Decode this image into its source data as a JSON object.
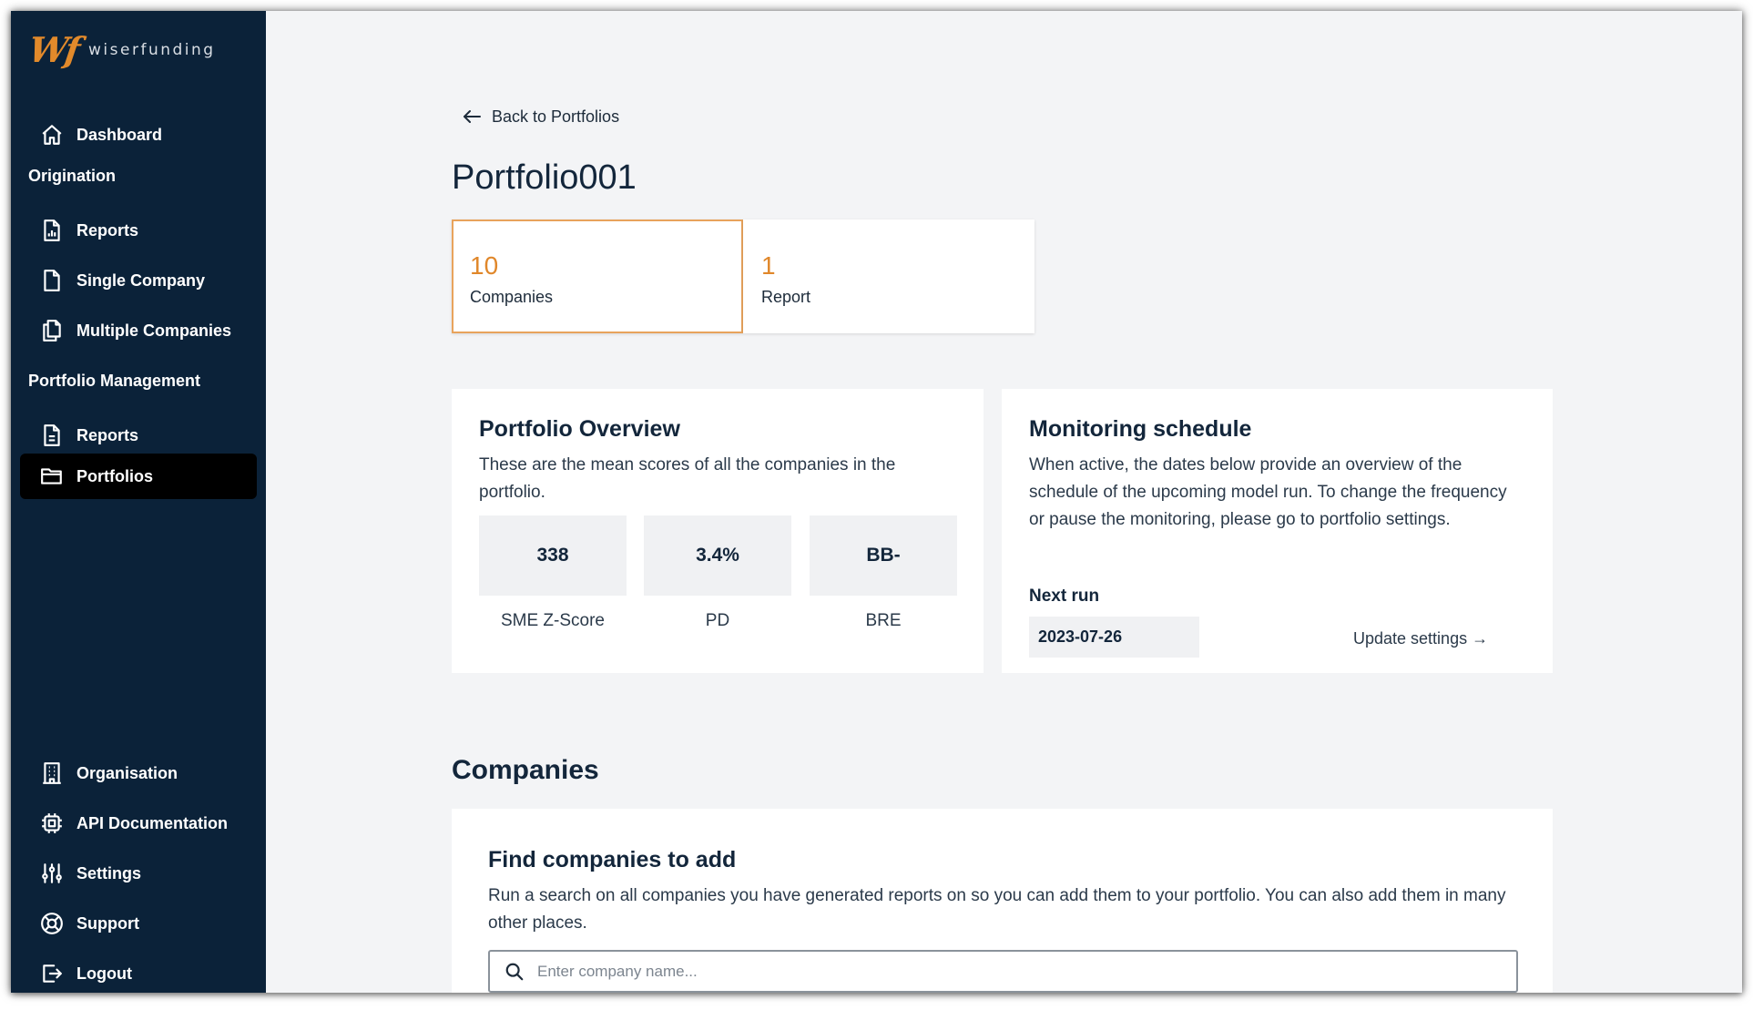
{
  "app": {
    "brand_mark": "Wf",
    "brand_name": "wiserfunding"
  },
  "sidebar": {
    "dashboard": "Dashboard",
    "section_origination": "Origination",
    "origination_reports": "Reports",
    "single_company": "Single Company",
    "multiple_companies": "Multiple Companies",
    "section_portfolio_management": "Portfolio Management",
    "portfolio_reports": "Reports",
    "portfolios": "Portfolios",
    "organisation": "Organisation",
    "api_documentation": "API Documentation",
    "settings": "Settings",
    "support": "Support",
    "logout": "Logout"
  },
  "header": {
    "back_label": "Back to Portfolios",
    "title": "Portfolio001"
  },
  "stats": {
    "companies_count": "10",
    "companies_label": "Companies",
    "report_count": "1",
    "report_label": "Report"
  },
  "overview": {
    "title": "Portfolio Overview",
    "description": "These are the mean scores of all the companies in the portfolio.",
    "scores": [
      {
        "value": "338",
        "label": "SME Z-Score"
      },
      {
        "value": "3.4%",
        "label": "PD"
      },
      {
        "value": "BB-",
        "label": "BRE"
      }
    ]
  },
  "monitoring": {
    "title": "Monitoring schedule",
    "description": "When active, the dates below provide an overview of the schedule of the upcoming model run. To change the frequency or pause the monitoring, please go to portfolio settings.",
    "next_run_label": "Next run",
    "next_run_value": "2023-07-26",
    "update_label": "Update settings →"
  },
  "companies": {
    "section_title": "Companies",
    "find_title": "Find companies to add",
    "find_description": "Run a search on all companies you have generated reports on so you can add them to your portfolio. You can also add them in many other places.",
    "search_placeholder": "Enter company name..."
  },
  "colors": {
    "sidebar_bg": "#0b2239",
    "accent": "#e0872a",
    "active_nav_bg": "#000000",
    "page_bg": "#f3f4f6"
  }
}
